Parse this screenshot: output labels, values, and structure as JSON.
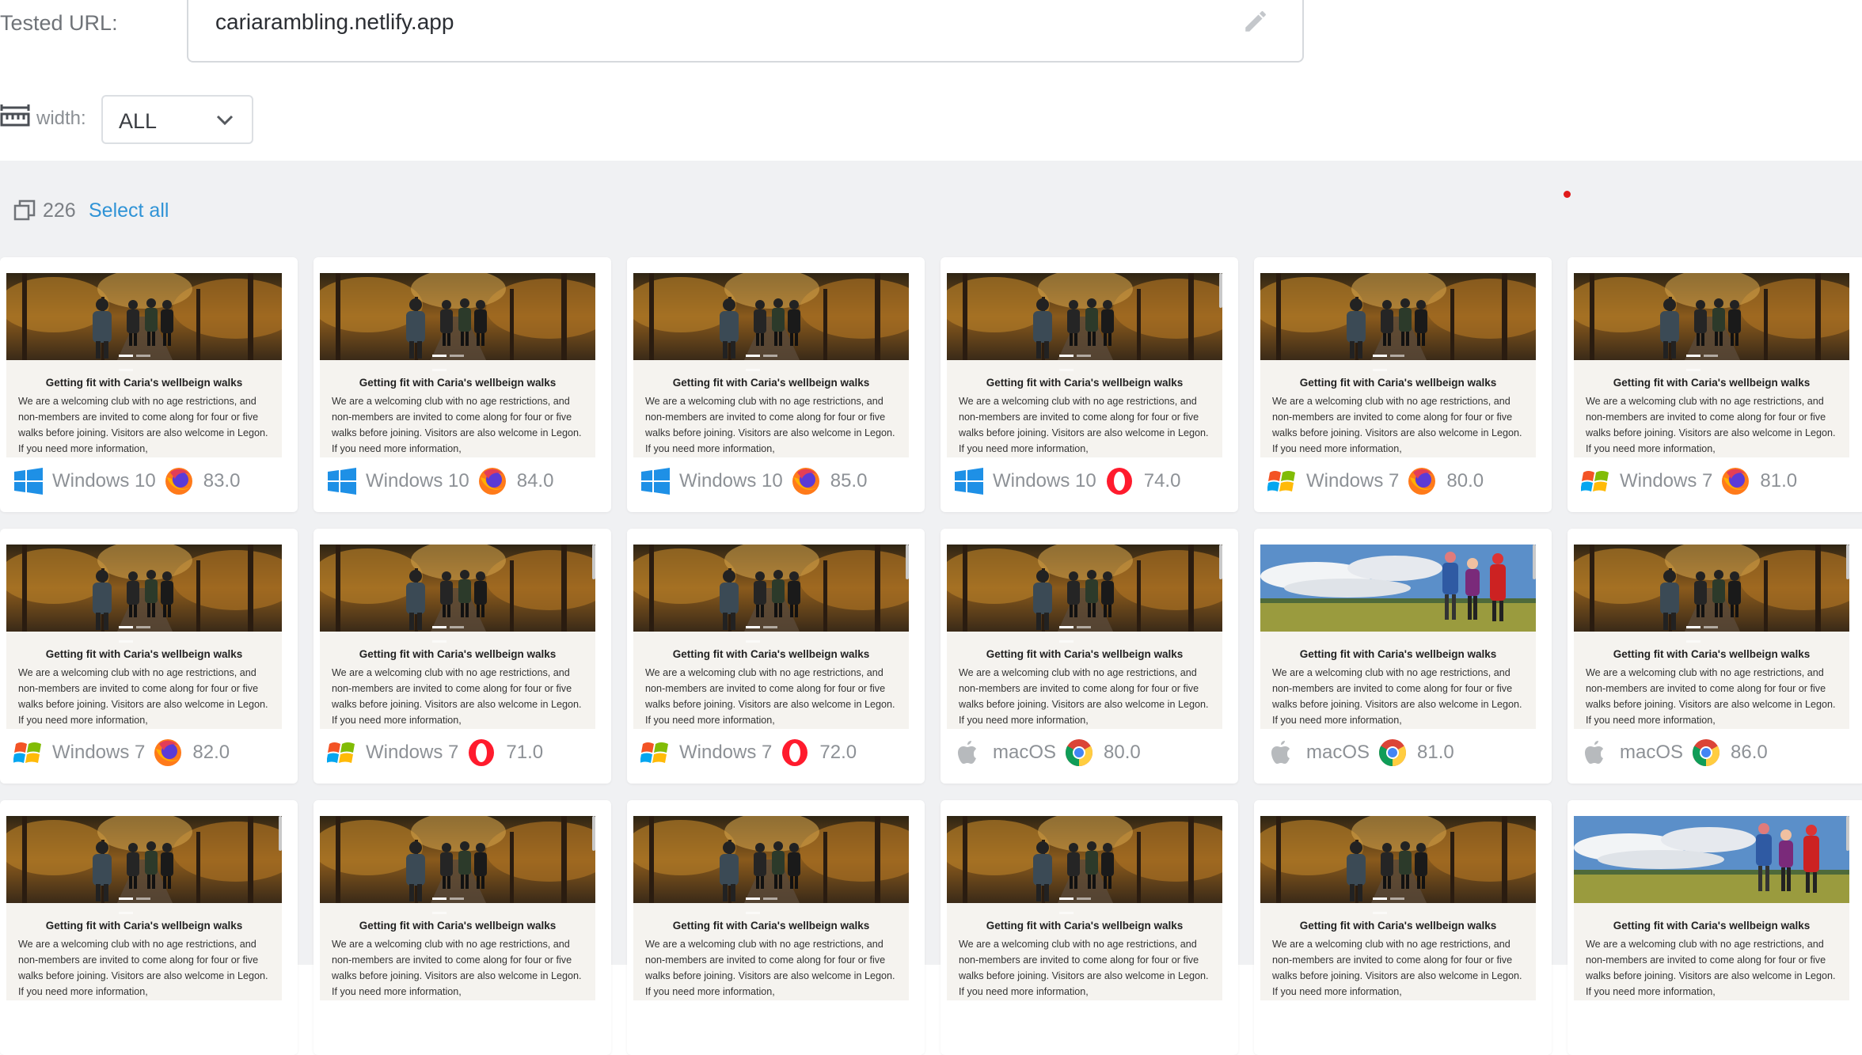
{
  "header": {
    "url_label": "Tested URL:",
    "url_value": "cariarambling.netlify.app",
    "width_label": "width:",
    "width_value": "ALL"
  },
  "selection": {
    "count": "226",
    "select_all_label": "Select all"
  },
  "screenshot_text": {
    "title": "Getting fit with Caria's wellbeign walks",
    "body": "We are a welcoming club with no age restrictions, and non-members are invited to come along for four or five walks before joining. Visitors are also welcome in Legon. If you need more information,"
  },
  "colors": {
    "accent_link": "#2f93d6",
    "content_bg": "#f0f1f3"
  },
  "results": [
    {
      "os": "Windows 10",
      "os_icon": "windows10-icon",
      "browser_icon": "firefox-icon",
      "version": "83.0",
      "hero": "forest",
      "scrollbar": false
    },
    {
      "os": "Windows 10",
      "os_icon": "windows10-icon",
      "browser_icon": "firefox-icon",
      "version": "84.0",
      "hero": "forest",
      "scrollbar": false
    },
    {
      "os": "Windows 10",
      "os_icon": "windows10-icon",
      "browser_icon": "firefox-icon",
      "version": "85.0",
      "hero": "forest",
      "scrollbar": false
    },
    {
      "os": "Windows 10",
      "os_icon": "windows10-icon",
      "browser_icon": "opera-icon",
      "version": "74.0",
      "hero": "forest",
      "scrollbar": true
    },
    {
      "os": "Windows 7",
      "os_icon": "windows7-icon",
      "browser_icon": "firefox-icon",
      "version": "80.0",
      "hero": "forest",
      "scrollbar": false
    },
    {
      "os": "Windows 7",
      "os_icon": "windows7-icon",
      "browser_icon": "firefox-icon",
      "version": "81.0",
      "hero": "forest",
      "scrollbar": false
    },
    {
      "os": "Windows 7",
      "os_icon": "windows7-icon",
      "browser_icon": "firefox-icon",
      "version": "82.0",
      "hero": "forest",
      "scrollbar": false
    },
    {
      "os": "Windows 7",
      "os_icon": "windows7-icon",
      "browser_icon": "opera-icon",
      "version": "71.0",
      "hero": "forest",
      "scrollbar": true
    },
    {
      "os": "Windows 7",
      "os_icon": "windows7-icon",
      "browser_icon": "opera-icon",
      "version": "72.0",
      "hero": "forest",
      "scrollbar": true
    },
    {
      "os": "macOS",
      "os_icon": "apple-icon",
      "browser_icon": "chrome-icon",
      "version": "80.0",
      "hero": "forest",
      "scrollbar": true
    },
    {
      "os": "macOS",
      "os_icon": "apple-icon",
      "browser_icon": "chrome-icon",
      "version": "81.0",
      "hero": "field",
      "scrollbar": true
    },
    {
      "os": "macOS",
      "os_icon": "apple-icon",
      "browser_icon": "chrome-icon",
      "version": "86.0",
      "hero": "forest",
      "scrollbar": true
    },
    {
      "os": "",
      "os_icon": "",
      "browser_icon": "",
      "version": "",
      "hero": "forest",
      "scrollbar": true
    },
    {
      "os": "",
      "os_icon": "",
      "browser_icon": "",
      "version": "",
      "hero": "forest",
      "scrollbar": true
    },
    {
      "os": "",
      "os_icon": "",
      "browser_icon": "",
      "version": "",
      "hero": "forest",
      "scrollbar": false
    },
    {
      "os": "",
      "os_icon": "",
      "browser_icon": "",
      "version": "",
      "hero": "forest",
      "scrollbar": false
    },
    {
      "os": "",
      "os_icon": "",
      "browser_icon": "",
      "version": "",
      "hero": "forest",
      "scrollbar": false
    },
    {
      "os": "",
      "os_icon": "",
      "browser_icon": "",
      "version": "",
      "hero": "field",
      "scrollbar": true
    }
  ]
}
